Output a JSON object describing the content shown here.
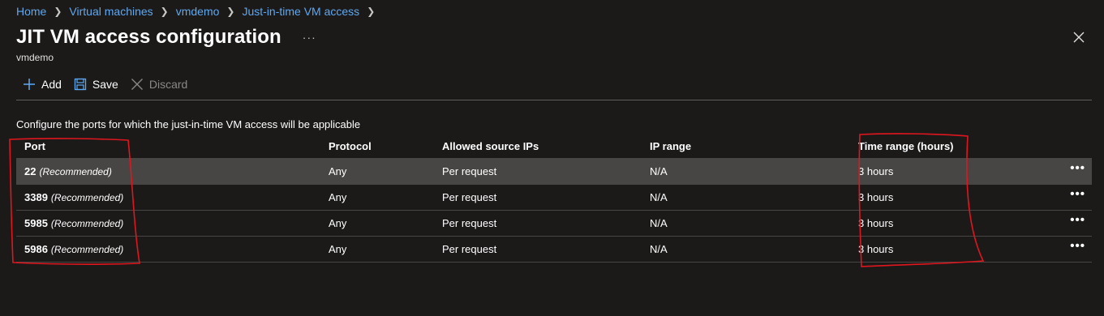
{
  "breadcrumb": [
    "Home",
    "Virtual machines",
    "vmdemo",
    "Just-in-time VM access"
  ],
  "header": {
    "title": "JIT VM access configuration",
    "subtitle": "vmdemo",
    "more_label": "···"
  },
  "toolbar": {
    "add_label": "Add",
    "save_label": "Save",
    "discard_label": "Discard"
  },
  "description": "Configure the ports for which the just-in-time VM access will be applicable",
  "table": {
    "columns": [
      "Port",
      "Protocol",
      "Allowed source IPs",
      "IP range",
      "Time range (hours)"
    ],
    "rows": [
      {
        "port": "22",
        "tag": "(Recommended)",
        "protocol": "Any",
        "source": "Per request",
        "ip_range": "N/A",
        "time_range": "3 hours",
        "more": "•••"
      },
      {
        "port": "3389",
        "tag": "(Recommended)",
        "protocol": "Any",
        "source": "Per request",
        "ip_range": "N/A",
        "time_range": "3 hours",
        "more": "•••"
      },
      {
        "port": "5985",
        "tag": "(Recommended)",
        "protocol": "Any",
        "source": "Per request",
        "ip_range": "N/A",
        "time_range": "3 hours",
        "more": "•••"
      },
      {
        "port": "5986",
        "tag": "(Recommended)",
        "protocol": "Any",
        "source": "Per request",
        "ip_range": "N/A",
        "time_range": "3 hours",
        "more": "•••"
      }
    ]
  },
  "colors": {
    "background": "#1b1a19",
    "link": "#5ea8f2",
    "selected_row": "#484644",
    "annotation": "#e0161e"
  }
}
